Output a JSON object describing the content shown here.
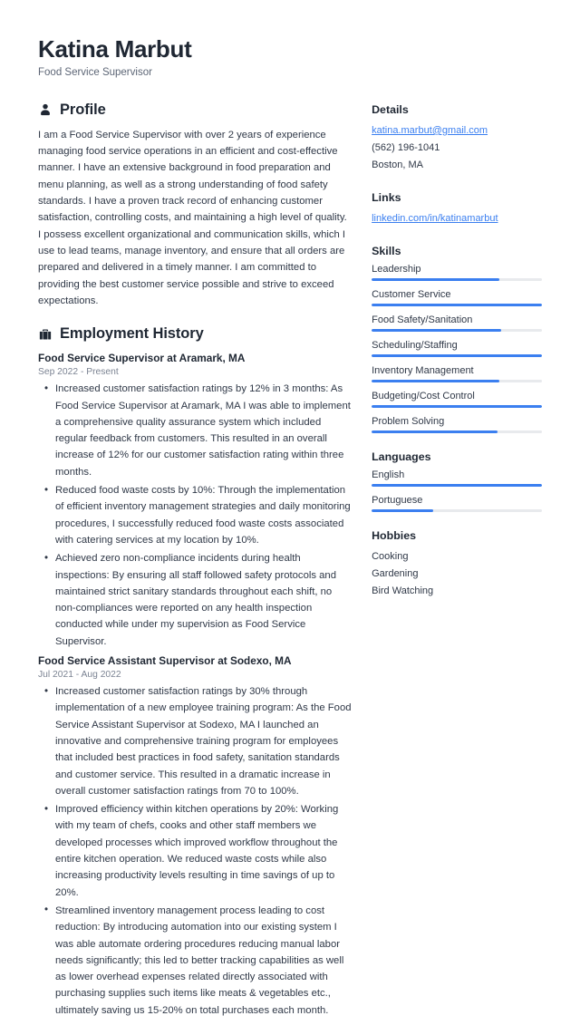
{
  "header": {
    "name": "Katina Marbut",
    "title": "Food Service Supervisor"
  },
  "accent_color": "#3b7ff0",
  "text_color": "#2f3847",
  "profile": {
    "icon": "user-icon",
    "title": "Profile",
    "text": "I am a Food Service Supervisor with over 2 years of experience managing food service operations in an efficient and cost-effective manner. I have an extensive background in food preparation and menu planning, as well as a strong understanding of food safety standards. I have a proven track record of enhancing customer satisfaction, controlling costs, and maintaining a high level of quality. I possess excellent organizational and communication skills, which I use to lead teams, manage inventory, and ensure that all orders are prepared and delivered in a timely manner. I am committed to providing the best customer service possible and strive to exceed expectations."
  },
  "employment": {
    "icon": "briefcase-icon",
    "title": "Employment History",
    "jobs": [
      {
        "heading": "Food Service Supervisor at Aramark, MA",
        "dates": "Sep 2022 - Present",
        "bullets": [
          "Increased customer satisfaction ratings by 12% in 3 months: As Food Service Supervisor at Aramark, MA I was able to implement a comprehensive quality assurance system which included regular feedback from customers. This resulted in an overall increase of 12% for our customer satisfaction rating within three months.",
          "Reduced food waste costs by 10%: Through the implementation of efficient inventory management strategies and daily monitoring procedures, I successfully reduced food waste costs associated with catering services at my location by 10%.",
          "Achieved zero non-compliance incidents during health inspections: By ensuring all staff followed safety protocols and maintained strict sanitary standards throughout each shift, no non-compliances were reported on any health inspection conducted while under my supervision as Food Service Supervisor."
        ]
      },
      {
        "heading": "Food Service Assistant Supervisor at Sodexo, MA",
        "dates": "Jul 2021 - Aug 2022",
        "bullets": [
          "Increased customer satisfaction ratings by 30% through implementation of a new employee training program: As the Food Service Assistant Supervisor at Sodexo, MA I launched an innovative and comprehensive training program for employees that included best practices in food safety, sanitation standards and customer service. This resulted in a dramatic increase in overall customer satisfaction ratings from 70 to 100%.",
          "Improved efficiency within kitchen operations by 20%: Working with my team of chefs, cooks and other staff members we developed processes which improved workflow throughout the entire kitchen operation. We reduced waste costs while also increasing productivity levels resulting in time savings of up to 20%.",
          "Streamlined inventory management process leading to cost reduction: By introducing automation into our existing system I was able automate ordering procedures reducing manual labor needs significantly; this led to better tracking capabilities as well as lower overhead expenses related directly associated with purchasing supplies such items like meats & vegetables etc., ultimately saving us 15-20% on total purchases each month."
        ]
      }
    ]
  },
  "details": {
    "title": "Details",
    "email": "katina.marbut@gmail.com",
    "phone": "(562) 196-1041",
    "location": "Boston, MA"
  },
  "links": {
    "title": "Links",
    "items": [
      {
        "label": "linkedin.com/in/katinamarbut"
      }
    ]
  },
  "skills": {
    "title": "Skills",
    "items": [
      {
        "label": "Leadership",
        "level": 75
      },
      {
        "label": "Customer Service",
        "level": 100
      },
      {
        "label": "Food Safety/Sanitation",
        "level": 76
      },
      {
        "label": "Scheduling/Staffing",
        "level": 100
      },
      {
        "label": "Inventory Management",
        "level": 75
      },
      {
        "label": "Budgeting/Cost Control",
        "level": 100
      },
      {
        "label": "Problem Solving",
        "level": 74
      }
    ]
  },
  "languages": {
    "title": "Languages",
    "items": [
      {
        "label": "English",
        "level": 100
      },
      {
        "label": "Portuguese",
        "level": 36
      }
    ]
  },
  "hobbies": {
    "title": "Hobbies",
    "items": [
      {
        "label": "Cooking"
      },
      {
        "label": "Gardening"
      },
      {
        "label": "Bird Watching"
      }
    ]
  }
}
